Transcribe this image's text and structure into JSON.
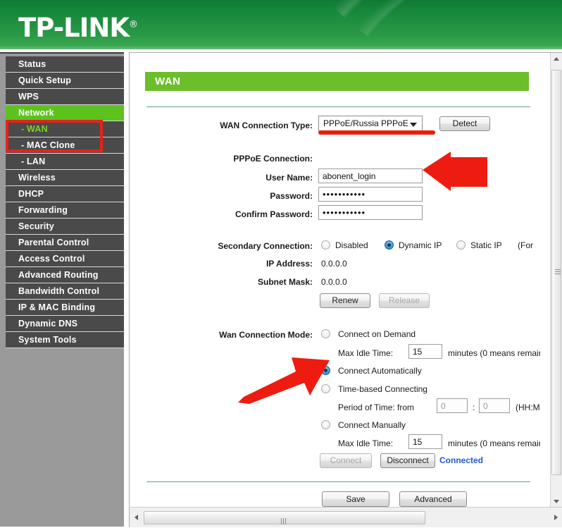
{
  "brand": {
    "name": "TP-LINK",
    "registered_mark": "®"
  },
  "sidebar": {
    "items": [
      {
        "label": "Status",
        "type": "top",
        "state": "normal"
      },
      {
        "label": "Quick Setup",
        "type": "top",
        "state": "normal"
      },
      {
        "label": "WPS",
        "type": "top",
        "state": "normal"
      },
      {
        "label": "Network",
        "type": "top",
        "state": "selected"
      },
      {
        "label": "- WAN",
        "type": "sub",
        "state": "active"
      },
      {
        "label": "- MAC Clone",
        "type": "sub",
        "state": "normal"
      },
      {
        "label": "- LAN",
        "type": "sub",
        "state": "normal"
      },
      {
        "label": "Wireless",
        "type": "top",
        "state": "normal"
      },
      {
        "label": "DHCP",
        "type": "top",
        "state": "normal"
      },
      {
        "label": "Forwarding",
        "type": "top",
        "state": "normal"
      },
      {
        "label": "Security",
        "type": "top",
        "state": "normal"
      },
      {
        "label": "Parental Control",
        "type": "top",
        "state": "normal"
      },
      {
        "label": "Access Control",
        "type": "top",
        "state": "normal"
      },
      {
        "label": "Advanced Routing",
        "type": "top",
        "state": "normal"
      },
      {
        "label": "Bandwidth Control",
        "type": "top",
        "state": "normal"
      },
      {
        "label": "IP & MAC Binding",
        "type": "top",
        "state": "normal"
      },
      {
        "label": "Dynamic DNS",
        "type": "top",
        "state": "normal"
      },
      {
        "label": "System Tools",
        "type": "top",
        "state": "normal"
      }
    ]
  },
  "page": {
    "title": "WAN"
  },
  "wan_type": {
    "label": "WAN Connection Type:",
    "value": "PPPoE/Russia PPPoE",
    "detect_button": "Detect"
  },
  "pppoe": {
    "section_label": "PPPoE Connection:",
    "username_label": "User Name:",
    "username_value": "abonent_login",
    "password_label": "Password:",
    "password_value": "•••••••••••",
    "confirm_label": "Confirm Password:",
    "confirm_value": "•••••••••••"
  },
  "secondary": {
    "label": "Secondary Connection:",
    "options": [
      {
        "label": "Disabled",
        "selected": false
      },
      {
        "label": "Dynamic IP",
        "selected": true
      },
      {
        "label": "Static IP",
        "selected": false
      }
    ],
    "trailing_note": "(For",
    "ip_address_label": "IP Address:",
    "ip_address_value": "0.0.0.0",
    "subnet_mask_label": "Subnet Mask:",
    "subnet_mask_value": "0.0.0.0",
    "renew_button": "Renew",
    "release_button": "Release"
  },
  "connection_mode": {
    "label": "Wan Connection Mode:",
    "on_demand": {
      "label": "Connect on Demand",
      "selected": false,
      "idle_label": "Max Idle Time:",
      "idle_value": "15",
      "idle_note": "minutes (0 means remair"
    },
    "automatic": {
      "label": "Connect Automatically",
      "selected": true
    },
    "time_based": {
      "label": "Time-based Connecting",
      "selected": false,
      "period_label": "Period of Time: from",
      "from_value": "0",
      "separator": ":",
      "to_value": "0",
      "format_note": "(HH:MM"
    },
    "manual": {
      "label": "Connect Manually",
      "selected": false,
      "idle_label": "Max Idle Time:",
      "idle_value": "15",
      "idle_note": "minutes (0 means remair"
    },
    "connect_button": "Connect",
    "disconnect_button": "Disconnect",
    "status": "Connected"
  },
  "footer": {
    "save_button": "Save",
    "advanced_button": "Advanced"
  },
  "colors": {
    "brand_green": "#1f8f3f",
    "title_bar_green": "#6cbe2a",
    "nav_selected_green": "#5dc21e",
    "nav_active_text_green": "#7ed321",
    "annotation_red": "#e8211a",
    "status_blue": "#2255dd"
  }
}
